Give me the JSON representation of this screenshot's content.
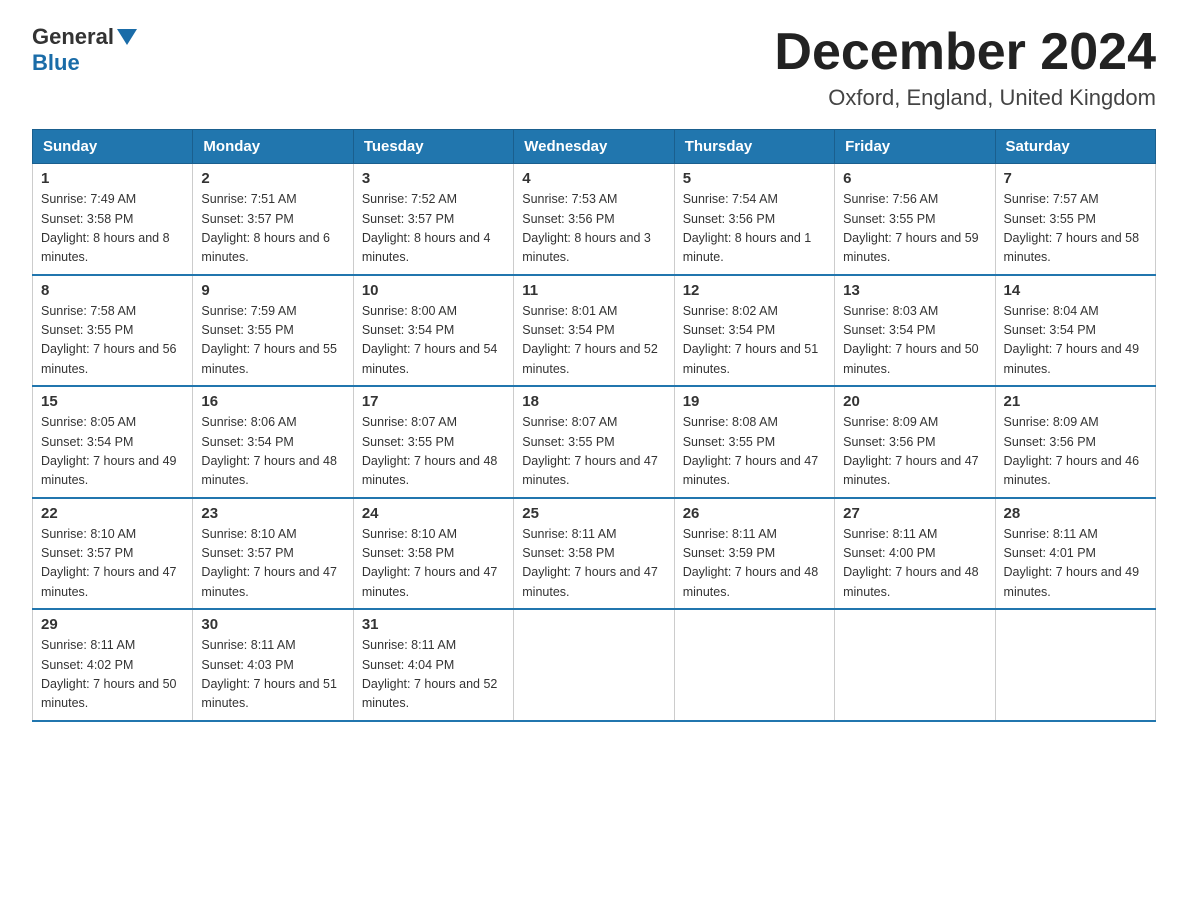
{
  "logo": {
    "general": "General",
    "blue": "Blue"
  },
  "title": "December 2024",
  "location": "Oxford, England, United Kingdom",
  "days_of_week": [
    "Sunday",
    "Monday",
    "Tuesday",
    "Wednesday",
    "Thursday",
    "Friday",
    "Saturday"
  ],
  "weeks": [
    [
      {
        "day": "1",
        "sunrise": "7:49 AM",
        "sunset": "3:58 PM",
        "daylight": "8 hours and 8 minutes."
      },
      {
        "day": "2",
        "sunrise": "7:51 AM",
        "sunset": "3:57 PM",
        "daylight": "8 hours and 6 minutes."
      },
      {
        "day": "3",
        "sunrise": "7:52 AM",
        "sunset": "3:57 PM",
        "daylight": "8 hours and 4 minutes."
      },
      {
        "day": "4",
        "sunrise": "7:53 AM",
        "sunset": "3:56 PM",
        "daylight": "8 hours and 3 minutes."
      },
      {
        "day": "5",
        "sunrise": "7:54 AM",
        "sunset": "3:56 PM",
        "daylight": "8 hours and 1 minute."
      },
      {
        "day": "6",
        "sunrise": "7:56 AM",
        "sunset": "3:55 PM",
        "daylight": "7 hours and 59 minutes."
      },
      {
        "day": "7",
        "sunrise": "7:57 AM",
        "sunset": "3:55 PM",
        "daylight": "7 hours and 58 minutes."
      }
    ],
    [
      {
        "day": "8",
        "sunrise": "7:58 AM",
        "sunset": "3:55 PM",
        "daylight": "7 hours and 56 minutes."
      },
      {
        "day": "9",
        "sunrise": "7:59 AM",
        "sunset": "3:55 PM",
        "daylight": "7 hours and 55 minutes."
      },
      {
        "day": "10",
        "sunrise": "8:00 AM",
        "sunset": "3:54 PM",
        "daylight": "7 hours and 54 minutes."
      },
      {
        "day": "11",
        "sunrise": "8:01 AM",
        "sunset": "3:54 PM",
        "daylight": "7 hours and 52 minutes."
      },
      {
        "day": "12",
        "sunrise": "8:02 AM",
        "sunset": "3:54 PM",
        "daylight": "7 hours and 51 minutes."
      },
      {
        "day": "13",
        "sunrise": "8:03 AM",
        "sunset": "3:54 PM",
        "daylight": "7 hours and 50 minutes."
      },
      {
        "day": "14",
        "sunrise": "8:04 AM",
        "sunset": "3:54 PM",
        "daylight": "7 hours and 49 minutes."
      }
    ],
    [
      {
        "day": "15",
        "sunrise": "8:05 AM",
        "sunset": "3:54 PM",
        "daylight": "7 hours and 49 minutes."
      },
      {
        "day": "16",
        "sunrise": "8:06 AM",
        "sunset": "3:54 PM",
        "daylight": "7 hours and 48 minutes."
      },
      {
        "day": "17",
        "sunrise": "8:07 AM",
        "sunset": "3:55 PM",
        "daylight": "7 hours and 48 minutes."
      },
      {
        "day": "18",
        "sunrise": "8:07 AM",
        "sunset": "3:55 PM",
        "daylight": "7 hours and 47 minutes."
      },
      {
        "day": "19",
        "sunrise": "8:08 AM",
        "sunset": "3:55 PM",
        "daylight": "7 hours and 47 minutes."
      },
      {
        "day": "20",
        "sunrise": "8:09 AM",
        "sunset": "3:56 PM",
        "daylight": "7 hours and 47 minutes."
      },
      {
        "day": "21",
        "sunrise": "8:09 AM",
        "sunset": "3:56 PM",
        "daylight": "7 hours and 46 minutes."
      }
    ],
    [
      {
        "day": "22",
        "sunrise": "8:10 AM",
        "sunset": "3:57 PM",
        "daylight": "7 hours and 47 minutes."
      },
      {
        "day": "23",
        "sunrise": "8:10 AM",
        "sunset": "3:57 PM",
        "daylight": "7 hours and 47 minutes."
      },
      {
        "day": "24",
        "sunrise": "8:10 AM",
        "sunset": "3:58 PM",
        "daylight": "7 hours and 47 minutes."
      },
      {
        "day": "25",
        "sunrise": "8:11 AM",
        "sunset": "3:58 PM",
        "daylight": "7 hours and 47 minutes."
      },
      {
        "day": "26",
        "sunrise": "8:11 AM",
        "sunset": "3:59 PM",
        "daylight": "7 hours and 48 minutes."
      },
      {
        "day": "27",
        "sunrise": "8:11 AM",
        "sunset": "4:00 PM",
        "daylight": "7 hours and 48 minutes."
      },
      {
        "day": "28",
        "sunrise": "8:11 AM",
        "sunset": "4:01 PM",
        "daylight": "7 hours and 49 minutes."
      }
    ],
    [
      {
        "day": "29",
        "sunrise": "8:11 AM",
        "sunset": "4:02 PM",
        "daylight": "7 hours and 50 minutes."
      },
      {
        "day": "30",
        "sunrise": "8:11 AM",
        "sunset": "4:03 PM",
        "daylight": "7 hours and 51 minutes."
      },
      {
        "day": "31",
        "sunrise": "8:11 AM",
        "sunset": "4:04 PM",
        "daylight": "7 hours and 52 minutes."
      },
      null,
      null,
      null,
      null
    ]
  ],
  "labels": {
    "sunrise": "Sunrise:",
    "sunset": "Sunset:",
    "daylight": "Daylight:"
  }
}
